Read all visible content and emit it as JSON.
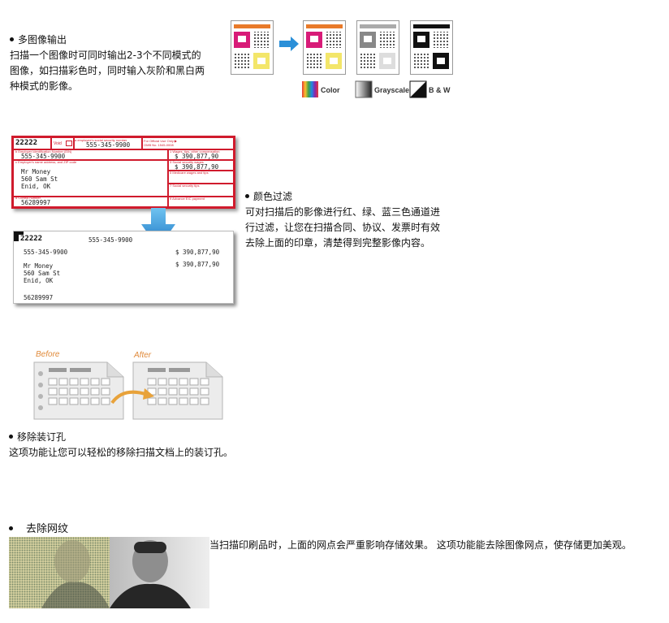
{
  "section1": {
    "title": "多图像输出",
    "desc": [
      "扫描一个图像时可同时输出2-3个不同模式的",
      "图像，如扫描彩色时，同时输入灰阶和黑白两",
      "种模式的影像。"
    ],
    "legend": [
      "Color",
      "Grayscale",
      "B & W"
    ]
  },
  "section2": {
    "title": "颜色过滤",
    "desc": [
      "可对扫描后的影像进行红、绿、蓝三色通道进",
      "行过滤，让您在扫描合同、协议、发票时有效",
      "去除上面的印章，清楚得到完整影像内容。"
    ],
    "form_before": {
      "box_id": "22222",
      "void_label": "Void",
      "ssn_label": "a employee's social security number",
      "ssn": "555-345-9900",
      "official_label": "For Official Use Only ▶",
      "omb": "OMB No. 1545-0008",
      "ein_label": "b Employer identification Number (EIN)",
      "ein": "555-345-9900",
      "wages_label": "1 Wages, tips, other compensation",
      "wages": "$ 390,877,90",
      "employer_label": "c Employer's name address, and ZIP code",
      "ss_wages_label": "3 Social security wages",
      "ss_wages": "$ 390,877,90",
      "medicare_label": "5 Medicare wages and tips",
      "ss_tips_label": "7 Social security tips",
      "name": "Mr Money",
      "address1": "560 Sam St",
      "address2": "Enid, OK",
      "control_label": "d Control number",
      "control": "56289997",
      "eic_label": "9 Advance EIC payment"
    },
    "form_after": {
      "box_id": "22222",
      "ssn": "555-345-9900",
      "ein": "555-345-9900",
      "wages": "$ 390,877,90",
      "ss_wages": "$ 390,877,90",
      "name": "Mr Money",
      "address1": "560 Sam St",
      "address2": "Enid, OK",
      "control": "56289997"
    }
  },
  "section3": {
    "title": "移除装订孔",
    "desc": "这项功能让您可以轻松的移除扫描文档上的装订孔。",
    "before_label": "Before",
    "after_label": "After"
  },
  "section4": {
    "title": "去除网纹",
    "desc": "当扫描印刷品时，上面的网点会严重影响存储效果。 这项功能能去除图像网点，使存储更加美观。"
  },
  "colors": {
    "accent_red": "#d01b2d",
    "arrow_blue": "#2a8fd8",
    "orange": "#e08a3a"
  }
}
